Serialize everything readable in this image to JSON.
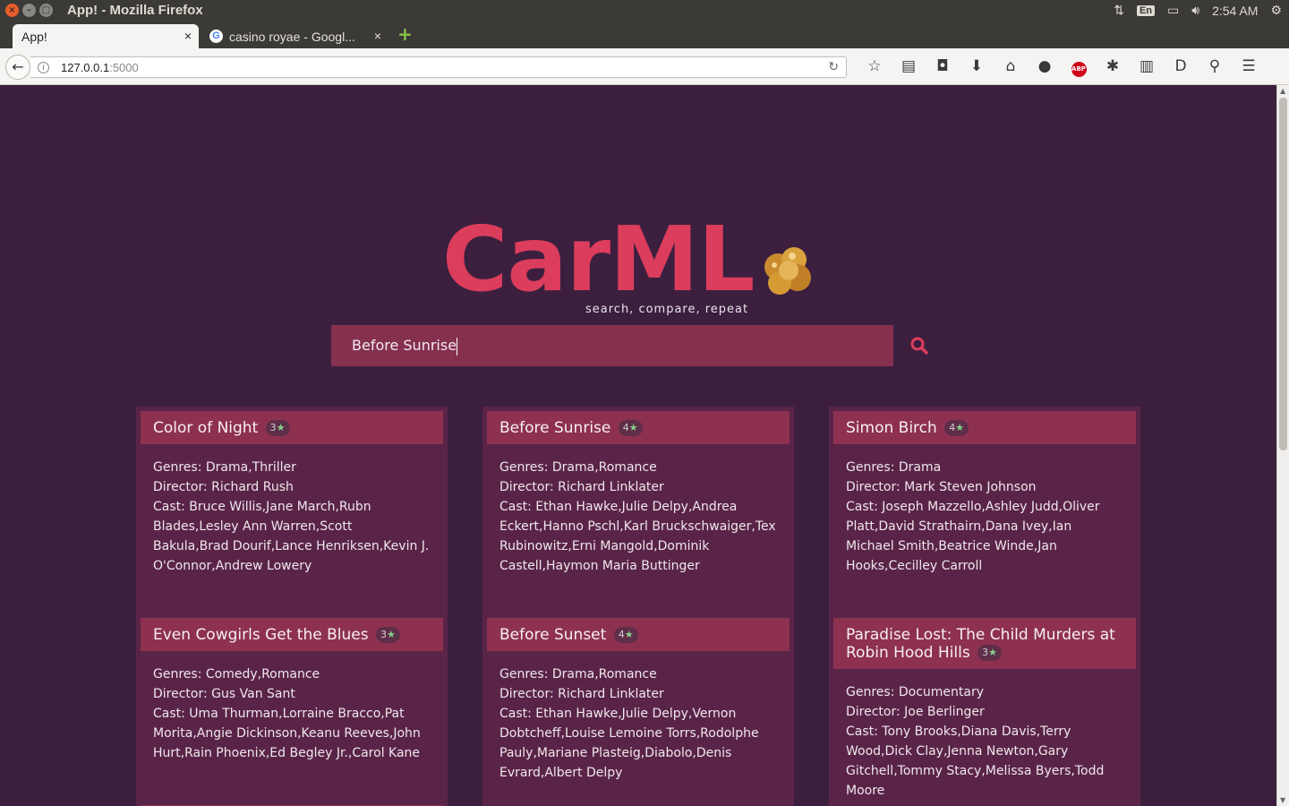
{
  "os": {
    "window_title": "App! - Mozilla Firefox",
    "lang": "En",
    "time": "2:54 AM"
  },
  "tabs": [
    {
      "label": "App!",
      "close": "×"
    },
    {
      "label": "casino royae - Googl...",
      "close": "×"
    }
  ],
  "nav": {
    "url_host": "127.0.0.1",
    "url_port": ":5000"
  },
  "app": {
    "logo": "CarML",
    "tagline": "search, compare, repeat",
    "search_value": "Before Sunrise"
  },
  "colors": {
    "background": "#3c1f3f",
    "accent": "#dc3d5c",
    "card_head": "#8e3150",
    "card_body": "#5a2448"
  },
  "movies": [
    {
      "title": "Color of Night",
      "rating": "3",
      "genres": "Genres: Drama,Thriller",
      "director": "Director: Richard Rush",
      "cast": "Cast: Bruce Willis,Jane March,Rubn Blades,Lesley Ann Warren,Scott Bakula,Brad Dourif,Lance Henriksen,Kevin J. O'Connor,Andrew Lowery"
    },
    {
      "title": "Even Cowgirls Get the Blues",
      "rating": "3",
      "genres": "Genres: Comedy,Romance",
      "director": "Director: Gus Van Sant",
      "cast": "Cast: Uma Thurman,Lorraine Bracco,Pat Morita,Angie Dickinson,Keanu Reeves,John Hurt,Rain Phoenix,Ed Begley Jr.,Carol Kane"
    },
    {
      "title": "Before Sunrise",
      "rating": "4",
      "genres": "Genres: Drama,Romance",
      "director": "Director: Richard Linklater",
      "cast": "Cast: Ethan Hawke,Julie Delpy,Andrea Eckert,Hanno Pschl,Karl Bruckschwaiger,Tex Rubinowitz,Erni Mangold,Dominik Castell,Haymon Maria Buttinger"
    },
    {
      "title": "Before Sunset",
      "rating": "4",
      "genres": "Genres: Drama,Romance",
      "director": "Director: Richard Linklater",
      "cast": "Cast: Ethan Hawke,Julie Delpy,Vernon Dobtcheff,Louise Lemoine Torrs,Rodolphe Pauly,Mariane Plasteig,Diabolo,Denis Evrard,Albert Delpy"
    },
    {
      "title": "Simon Birch",
      "rating": "4",
      "genres": "Genres: Drama",
      "director": "Director: Mark Steven Johnson",
      "cast": "Cast: Joseph Mazzello,Ashley Judd,Oliver Platt,David Strathairn,Dana Ivey,Ian Michael Smith,Beatrice Winde,Jan Hooks,Cecilley Carroll"
    },
    {
      "title": "Paradise Lost: The Child Murders at Robin Hood Hills",
      "rating": "3",
      "genres": "Genres: Documentary",
      "director": "Director: Joe Berlinger",
      "cast": "Cast: Tony Brooks,Diana Davis,Terry Wood,Dick Clay,Jenna Newton,Gary Gitchell,Tommy Stacy,Melissa Byers,Todd Moore"
    }
  ]
}
